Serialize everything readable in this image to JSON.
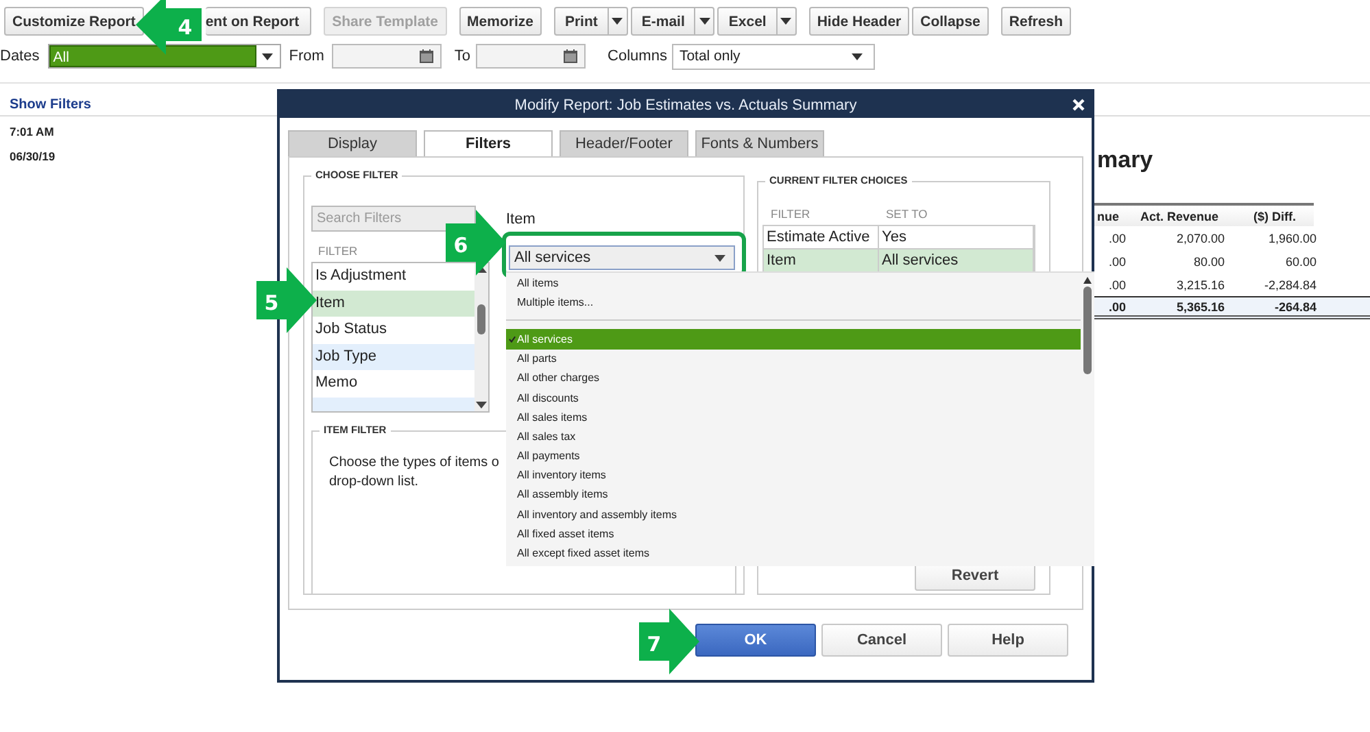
{
  "toolbar": {
    "groups": [
      {
        "buttons": [
          {
            "label": "Customize Report",
            "disabled": false,
            "menu": false
          },
          {
            "label": "ent on Report",
            "disabled": false,
            "menu": false
          }
        ]
      },
      {
        "buttons": [
          {
            "label": "Share Template",
            "disabled": true,
            "menu": false
          }
        ]
      },
      {
        "buttons": [
          {
            "label": "Memorize",
            "disabled": false,
            "menu": false
          }
        ]
      },
      {
        "buttons": [
          {
            "label": "Print",
            "disabled": false,
            "menu": true
          },
          {
            "label": "E-mail",
            "disabled": false,
            "menu": true
          },
          {
            "label": "Excel",
            "disabled": false,
            "menu": true
          }
        ]
      },
      {
        "buttons": [
          {
            "label": "Hide Header",
            "disabled": false,
            "menu": false
          },
          {
            "label": "Collapse",
            "disabled": false,
            "menu": false
          }
        ]
      },
      {
        "buttons": [
          {
            "label": "Refresh",
            "disabled": false,
            "menu": false
          }
        ]
      }
    ]
  },
  "filter_bar": {
    "dates_label": "Dates",
    "dates_value": "All",
    "from_label": "From",
    "to_label": "To",
    "columns_label": "Columns",
    "columns_value": "Total only"
  },
  "report": {
    "show_filters": "Show Filters",
    "time": "7:01 AM",
    "date": "06/30/19",
    "title": "mary",
    "columns": [
      "nue",
      "Act. Revenue",
      "($) Diff."
    ],
    "rows": [
      {
        "cells": [
          ".00",
          "2,070.00",
          "1,960.00"
        ],
        "total": false
      },
      {
        "cells": [
          ".00",
          "80.00",
          "60.00"
        ],
        "total": false
      },
      {
        "cells": [
          ".00",
          "3,215.16",
          "-2,284.84"
        ],
        "total": false
      },
      {
        "cells": [
          ".00",
          "5,365.16",
          "-264.84"
        ],
        "total": true
      }
    ]
  },
  "dialog": {
    "title": "Modify Report: Job Estimates vs. Actuals Summary",
    "tabs": [
      {
        "label": "Display",
        "selected": false
      },
      {
        "label": "Filters",
        "selected": true
      },
      {
        "label": "Header/Footer",
        "selected": false
      },
      {
        "label": "Fonts & Numbers",
        "selected": false
      }
    ],
    "choose_filter": {
      "heading": "CHOOSE FILTER",
      "search_placeholder": "Search Filters",
      "list_heading": "FILTER",
      "filters": [
        {
          "label": "Is Adjustment",
          "selected": false
        },
        {
          "label": "Item",
          "selected": true
        },
        {
          "label": "Job Status",
          "selected": false
        },
        {
          "label": "Job Type",
          "selected": false
        },
        {
          "label": "Memo",
          "selected": false
        }
      ],
      "item_label": "Item",
      "item_value": "All services"
    },
    "item_filter": {
      "heading": "ITEM FILTER",
      "lines": [
        "Choose the types of items o",
        "drop-down list."
      ]
    },
    "current": {
      "heading": "CURRENT FILTER CHOICES",
      "columns": [
        "FILTER",
        "SET TO"
      ],
      "rows": [
        {
          "filter": "Estimate Active",
          "set_to": "Yes",
          "selected": false
        },
        {
          "filter": "Item",
          "set_to": "All services",
          "selected": true
        }
      ]
    },
    "revert": "Revert",
    "buttons": [
      {
        "label": "OK",
        "kind": "primary"
      },
      {
        "label": "Cancel",
        "kind": "normal"
      },
      {
        "label": "Help",
        "kind": "normal"
      }
    ]
  },
  "dropdown": {
    "options": [
      {
        "kind": "option",
        "label": "All items",
        "selected": false
      },
      {
        "kind": "option",
        "label": "Multiple items...",
        "selected": false
      },
      {
        "kind": "separator"
      },
      {
        "kind": "option",
        "label": "All services",
        "selected": true
      },
      {
        "kind": "option",
        "label": "All parts",
        "selected": false
      },
      {
        "kind": "option",
        "label": "All other charges",
        "selected": false
      },
      {
        "kind": "option",
        "label": "All discounts",
        "selected": false
      },
      {
        "kind": "option",
        "label": "All sales items",
        "selected": false
      },
      {
        "kind": "option",
        "label": "All sales tax",
        "selected": false
      },
      {
        "kind": "option",
        "label": "All payments",
        "selected": false
      },
      {
        "kind": "option",
        "label": "All inventory items",
        "selected": false
      },
      {
        "kind": "option",
        "label": "All assembly items",
        "selected": false
      },
      {
        "kind": "option",
        "label": "All inventory and assembly items",
        "selected": false
      },
      {
        "kind": "option",
        "label": "All fixed asset items",
        "selected": false
      },
      {
        "kind": "option",
        "label": "All except fixed asset items",
        "selected": false
      }
    ]
  },
  "callouts": [
    {
      "number": "4",
      "kind": "left"
    },
    {
      "number": "5",
      "kind": "right"
    },
    {
      "number": "6",
      "kind": "right"
    },
    {
      "number": "7",
      "kind": "right"
    }
  ]
}
